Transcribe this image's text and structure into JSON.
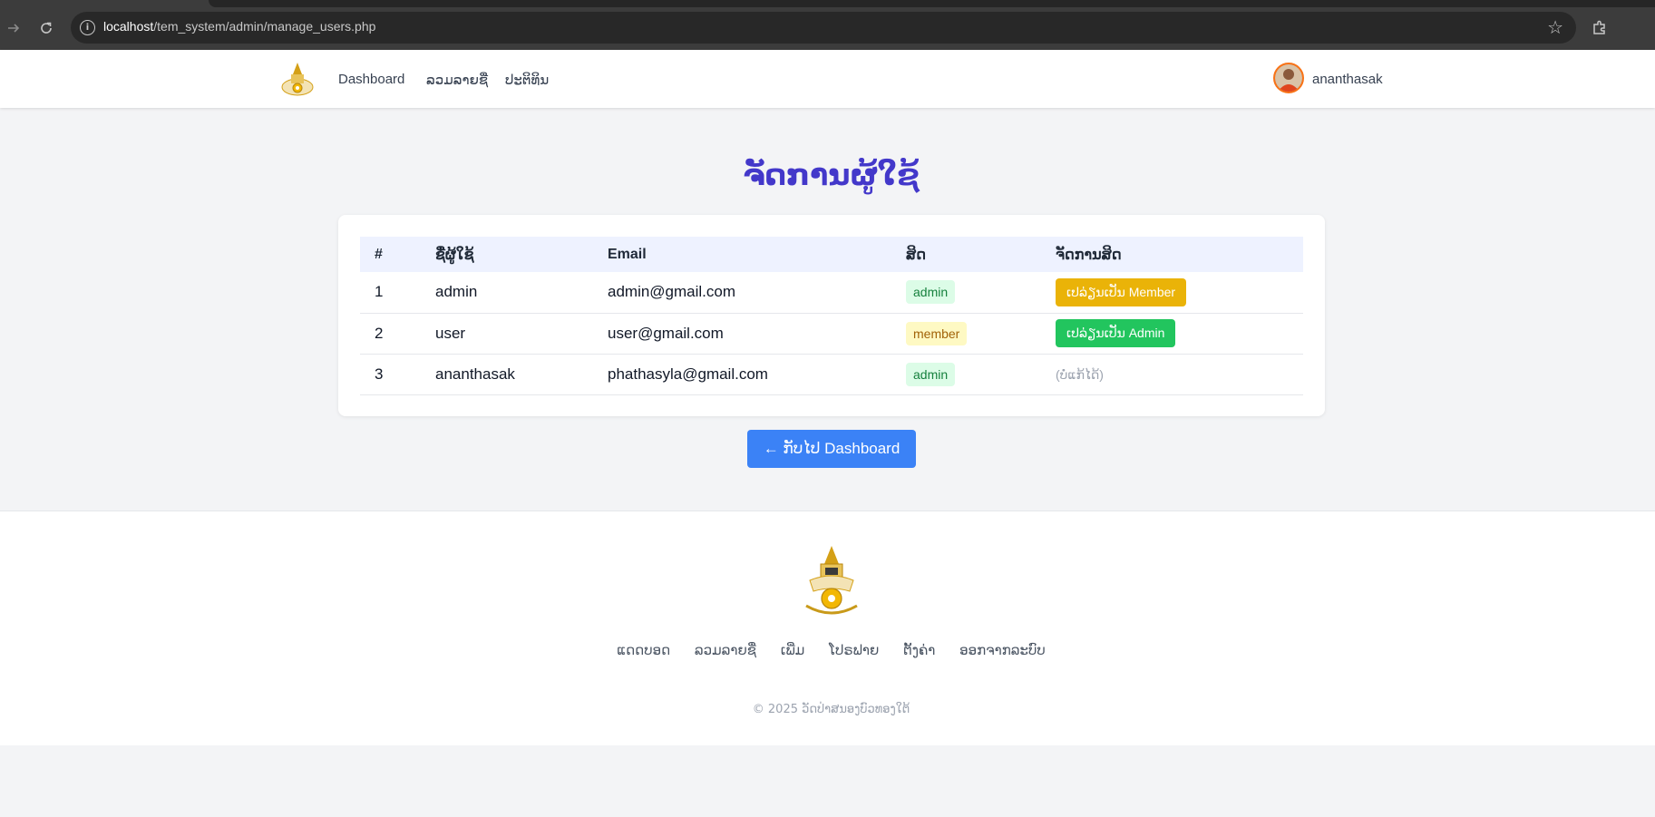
{
  "browser": {
    "url_host": "localhost",
    "url_path": "/tem_system/admin/manage_users.php"
  },
  "navbar": {
    "links": [
      "Dashboard",
      "ລວມລາຍຊື່",
      "ປະຕິທິນ"
    ],
    "username": "ananthasak"
  },
  "page": {
    "title": "ຈັດການຜູ້ໃຊ້"
  },
  "table": {
    "headers": [
      "#",
      "ຊື່ຜູ້ໃຊ້",
      "Email",
      "ສິດ",
      "ຈັດການສິດ"
    ],
    "rows": [
      {
        "no": "1",
        "username": "admin",
        "email": "admin@gmail.com",
        "role": "admin",
        "action": "ເປລ່ຽນເປັນ Member"
      },
      {
        "no": "2",
        "username": "user",
        "email": "user@gmail.com",
        "role": "member",
        "action": "ເປລ່ຽນເປັນ Admin"
      },
      {
        "no": "3",
        "username": "ananthasak",
        "email": "phathasyla@gmail.com",
        "role": "admin",
        "action": "(ບໍ່ແກ້ໄດ້)"
      }
    ]
  },
  "back_button": "← ກັບໄປ Dashboard",
  "footer": {
    "links": [
      "ແດດບອດ",
      "ລວມລາຍຊື່",
      "ເພີ່ມ",
      "ໂປຣຟາຍ",
      "ຕັ້ງຄ່າ",
      "ອອກຈາກລະບົບ"
    ],
    "copyright": "© 2025 ວັດປ່າສນອງບົວທອງໃຕ້"
  },
  "colors": {
    "title": "#4338ca",
    "primary_button": "#3b82f6",
    "to_member_button": "#eab308",
    "to_admin_button": "#22c55e"
  },
  "icons": [
    "forward-icon",
    "reload-icon",
    "site-info-icon",
    "bookmark-star-icon",
    "extensions-icon",
    "site-logo",
    "user-avatar"
  ]
}
